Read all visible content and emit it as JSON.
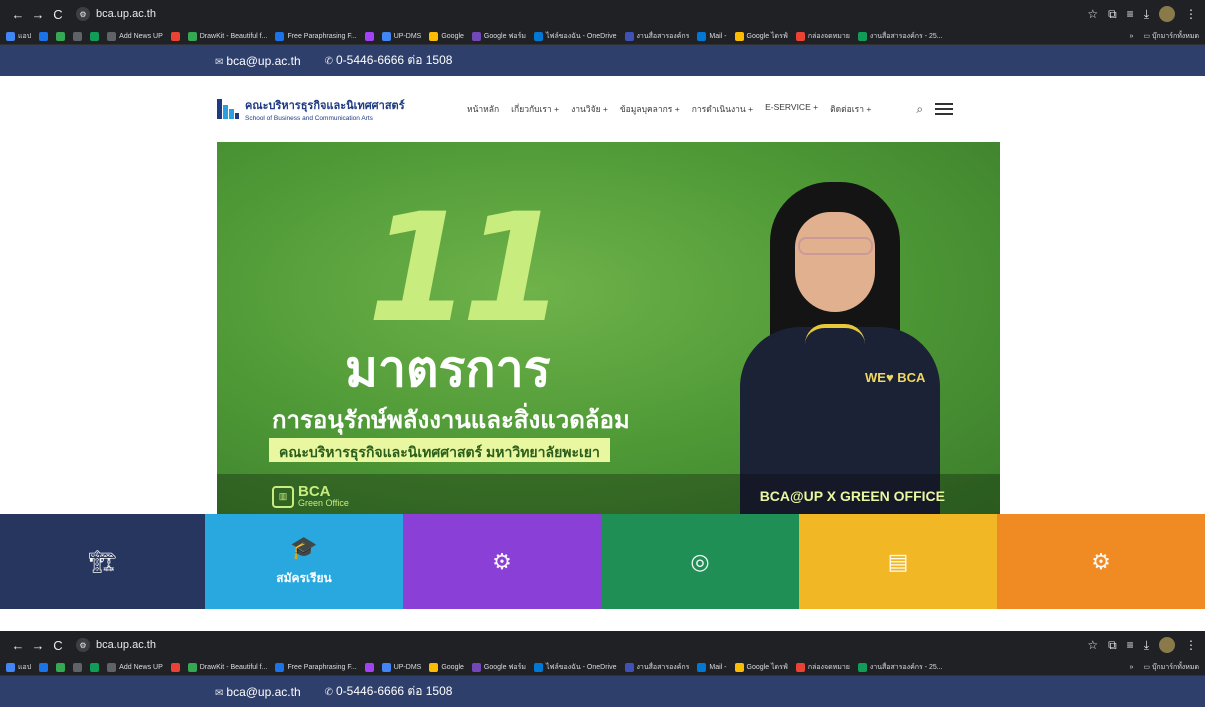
{
  "browser": {
    "url": "bca.up.ac.th",
    "nav": {
      "back": "←",
      "forward": "→",
      "reload": "C"
    },
    "bookmarks": [
      {
        "label": "แอป",
        "color": "#4285f4"
      },
      {
        "label": "",
        "color": "#1a73e8"
      },
      {
        "label": "",
        "color": "#34a853"
      },
      {
        "label": "",
        "color": "#5f6368"
      },
      {
        "label": "",
        "color": "#0f9d58"
      },
      {
        "label": "Add News UP",
        "color": "#5f6368"
      },
      {
        "label": "",
        "color": "#ea4335"
      },
      {
        "label": "DrawKit - Beautiful f...",
        "color": "#34a853"
      },
      {
        "label": "Free Paraphrasing F...",
        "color": "#1a73e8"
      },
      {
        "label": "",
        "color": "#a142f4"
      },
      {
        "label": "UP-DMS",
        "color": "#4285f4"
      },
      {
        "label": "Google",
        "color": "#fbbc04"
      },
      {
        "label": "Google ฟอร์ม",
        "color": "#7248b9"
      },
      {
        "label": "ไฟล์ของฉัน - OneDrive",
        "color": "#0078d4"
      },
      {
        "label": "งานสื่อสารองค์กร",
        "color": "#3f51b5"
      },
      {
        "label": "Mail -",
        "color": "#0078d4"
      },
      {
        "label": "Google ไดรฟ์",
        "color": "#fbbc04"
      },
      {
        "label": "กล่องจดหมาย",
        "color": "#ea4335"
      },
      {
        "label": "งานสื่อสารองค์กร - 25...",
        "color": "#0f9d58"
      }
    ],
    "bookmarks_more": "»",
    "all_bookmarks": "บุ๊กมาร์กทั้งหมด"
  },
  "topbar": {
    "email": "bca@up.ac.th",
    "phone": "0-5446-6666 ต่อ 1508"
  },
  "header": {
    "logo_th": "คณะบริหารธุรกิจและนิเทศศาสตร์",
    "logo_en": "School of Business and Communication Arts",
    "menu": [
      "หน้าหลัก",
      "เกี่ยวกับเรา +",
      "งานวิจัย +",
      "ข้อมูลบุคลากร +",
      "การดำเนินงาน +",
      "E-SERVICE +",
      "ติดต่อเรา +"
    ]
  },
  "banner": {
    "number": "11",
    "headline": "มาตรการ",
    "subline": "การอนุรักษ์พลังงานและสิ่งแวดล้อม",
    "faculty": "คณะบริหารธุรกิจและนิเทศศาสตร์ มหาวิทยาลัยพะเยา",
    "logo_title": "BCA",
    "logo_sub": "Green Office",
    "tag": "BCA@UP X GREEN OFFICE",
    "shirt_text": "WE♥ BCA"
  },
  "tiles": [
    {
      "label": "",
      "color": "#26365f",
      "icon": "🏗"
    },
    {
      "label": "สมัครเรียน",
      "color": "#29a8df",
      "icon": "🎓"
    },
    {
      "label": "",
      "color": "#8a3fd6",
      "icon": "⚙"
    },
    {
      "label": "",
      "color": "#1f8f55",
      "icon": "◎"
    },
    {
      "label": "",
      "color": "#f2b724",
      "icon": "▤"
    },
    {
      "label": "",
      "color": "#f08a22",
      "icon": "⚙"
    }
  ]
}
